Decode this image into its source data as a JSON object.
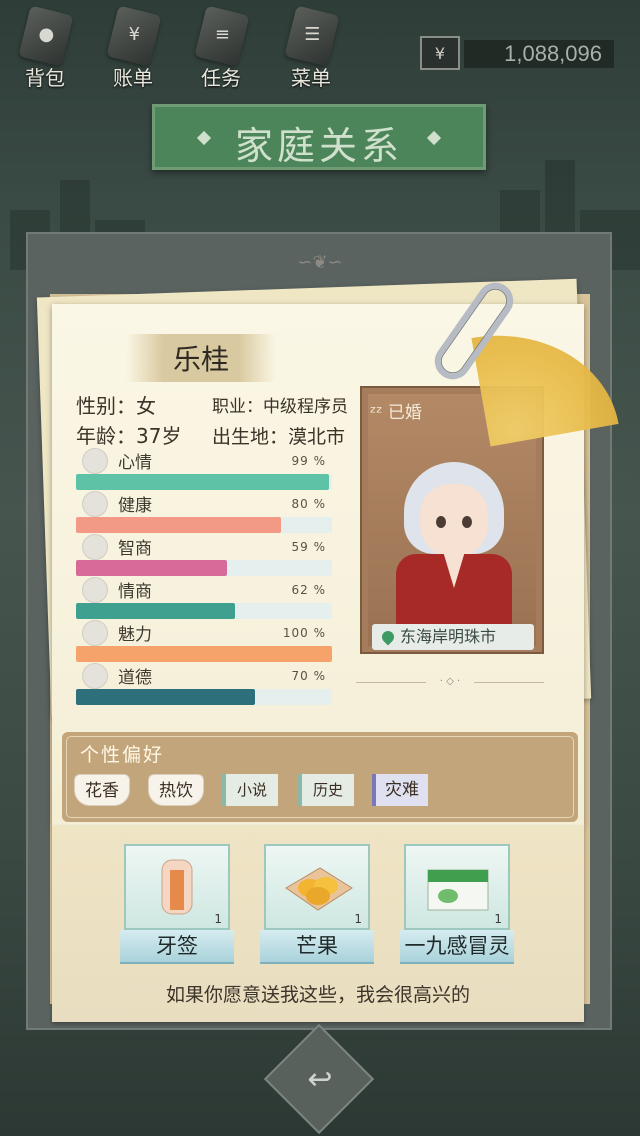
{
  "top_menu": [
    {
      "label": "背包",
      "icon": "backpack-icon"
    },
    {
      "label": "账单",
      "icon": "bill-icon"
    },
    {
      "label": "任务",
      "icon": "task-icon"
    },
    {
      "label": "菜单",
      "icon": "menu-icon"
    }
  ],
  "money": {
    "symbol": "¥",
    "value": "1,088,096"
  },
  "title": "家庭关系",
  "profile": {
    "name": "乐桂",
    "gender": "性别：女",
    "occupation": "职业：中级程序员",
    "age": "年龄：37岁",
    "birthplace": "出生地：漠北市",
    "status": "已婚",
    "location": "东海岸明珠市"
  },
  "stats": [
    {
      "label": "心情",
      "pct_text": "99 %",
      "value": 99,
      "color": "#5ec2a6"
    },
    {
      "label": "健康",
      "pct_text": "80 %",
      "value": 80,
      "color": "#f29a86"
    },
    {
      "label": "智商",
      "pct_text": "59 %",
      "value": 59,
      "color": "#d86a9a"
    },
    {
      "label": "情商",
      "pct_text": "62 %",
      "value": 62,
      "color": "#3fa08f"
    },
    {
      "label": "魅力",
      "pct_text": "100 %",
      "value": 100,
      "color": "#f5a26b"
    },
    {
      "label": "道德",
      "pct_text": "70 %",
      "value": 70,
      "color": "#2d6f7b"
    }
  ],
  "preferences": {
    "title": "个性偏好",
    "tags": [
      "花香",
      "热饮",
      "小说",
      "历史",
      "灾难"
    ]
  },
  "gifts": [
    {
      "name": "牙签",
      "count": "1"
    },
    {
      "name": "芒果",
      "count": "1"
    },
    {
      "name": "一九感冒灵",
      "count": "1"
    }
  ],
  "gift_message": "如果你愿意送我这些，我会很高兴的"
}
